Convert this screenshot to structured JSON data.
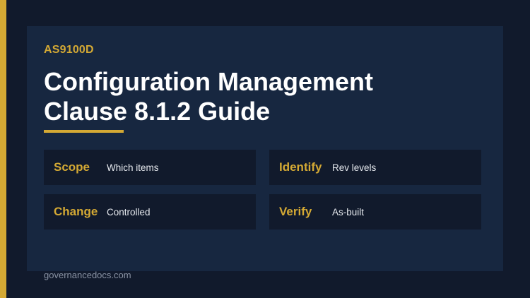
{
  "header": {
    "badge": "AS9100D",
    "title_line1": "Configuration Management",
    "title_line2": "Clause 8.1.2 Guide"
  },
  "cards": [
    {
      "label": "Scope",
      "value": "Which items"
    },
    {
      "label": "Identify",
      "value": "Rev levels"
    },
    {
      "label": "Change",
      "value": "Controlled"
    },
    {
      "label": "Verify",
      "value": "As-built"
    }
  ],
  "footer": {
    "site": "governancedocs.com"
  },
  "colors": {
    "background": "#111a2c",
    "panel": "#172740",
    "accent": "#d4a934",
    "title": "#ffffff"
  }
}
